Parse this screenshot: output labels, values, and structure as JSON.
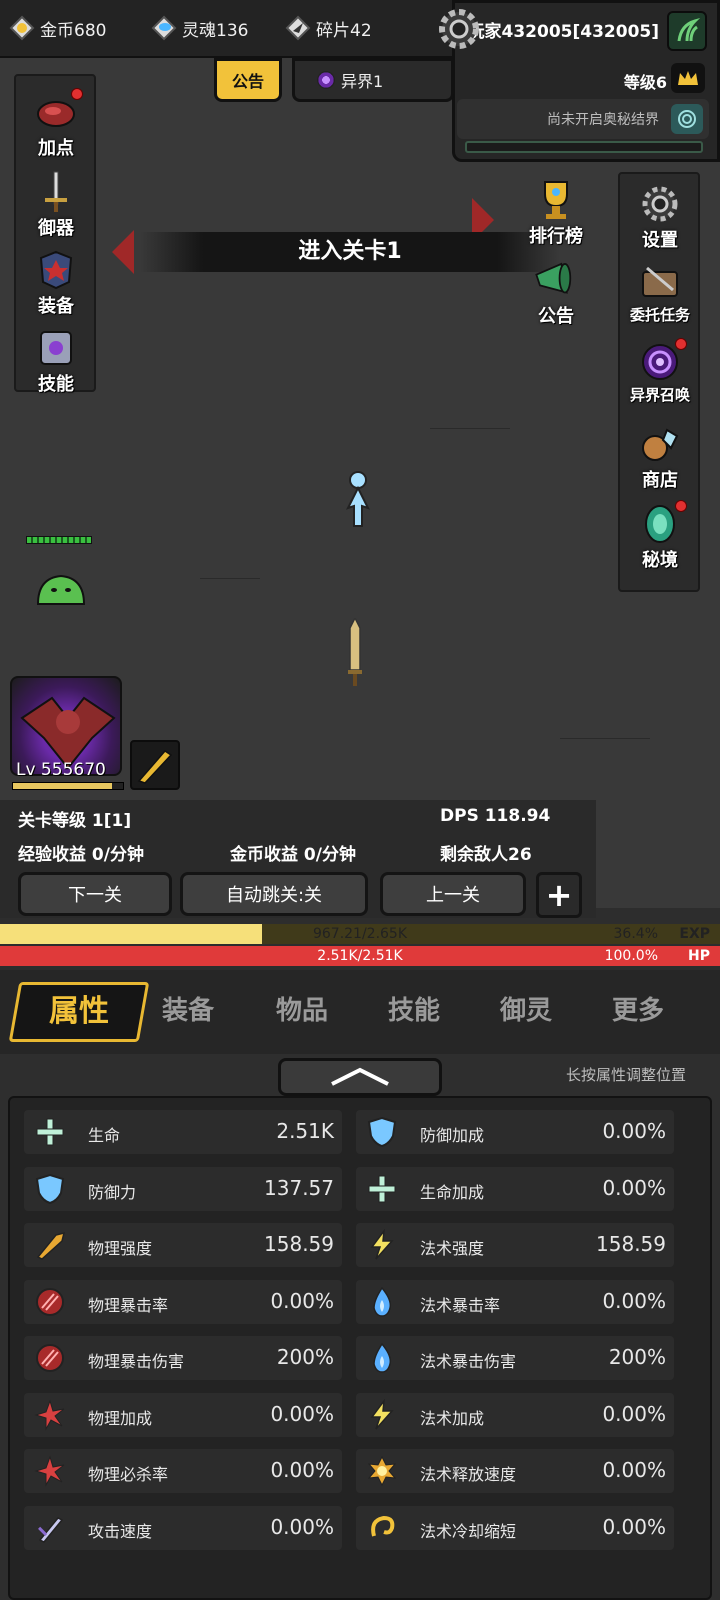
{
  "resources": {
    "gold": "金币680",
    "soul": "灵魂136",
    "shard": "碎片42"
  },
  "player": {
    "name": "玩家432005[432005]",
    "level": "等级6",
    "secret_status": "尚未开启奥秘结界"
  },
  "top_tabs": {
    "notice": "公告",
    "world": "异界1"
  },
  "left_menu": [
    "加点",
    "御器",
    "装备",
    "技能"
  ],
  "scene": {
    "ranking": "排行榜",
    "notice": "公告",
    "stage_title": "进入关卡1"
  },
  "right_menu": [
    "设置",
    "委托任务",
    "异界召唤",
    "商店",
    "秘境"
  ],
  "hero": {
    "level_label": "Lv 555670",
    "xp_fraction": 0.9
  },
  "stats": {
    "stage_level": "关卡等级 1[1]",
    "dps": "DPS  118.94",
    "exp_income": "经验收益 0/分钟",
    "gold_income": "金币收益 0/分钟",
    "enemies_left": "剩余敌人26"
  },
  "stage_buttons": {
    "next": "下一关",
    "auto": "自动跳关:关",
    "prev": "上一关",
    "plus": "+"
  },
  "exp_bar": {
    "text": "967.21/2.65K",
    "percent": "36.4%",
    "tag": "EXP",
    "fraction": 0.364
  },
  "hp_bar": {
    "text": "2.51K/2.51K",
    "percent": "100.0%",
    "tag": "HP",
    "fraction": 1.0
  },
  "bottom_tabs": [
    "属性",
    "装备",
    "物品",
    "技能",
    "御灵",
    "更多"
  ],
  "attr_hint": "长按属性调整位置",
  "attributes_left": [
    {
      "name": "生命",
      "value": "2.51K",
      "icon": "plus-icon"
    },
    {
      "name": "防御力",
      "value": "137.57",
      "icon": "shield-icon"
    },
    {
      "name": "物理强度",
      "value": "158.59",
      "icon": "blade-icon"
    },
    {
      "name": "物理暴击率",
      "value": "0.00%",
      "icon": "claw-icon"
    },
    {
      "name": "物理暴击伤害",
      "value": "200%",
      "icon": "claw-icon"
    },
    {
      "name": "物理加成",
      "value": "0.00%",
      "icon": "burst-icon"
    },
    {
      "name": "物理必杀率",
      "value": "0.00%",
      "icon": "burst-icon"
    },
    {
      "name": "攻击速度",
      "value": "0.00%",
      "icon": "sword-icon"
    }
  ],
  "attributes_right": [
    {
      "name": "防御加成",
      "value": "0.00%",
      "icon": "shield-icon"
    },
    {
      "name": "生命加成",
      "value": "0.00%",
      "icon": "plus-icon"
    },
    {
      "name": "法术强度",
      "value": "158.59",
      "icon": "lightning-icon"
    },
    {
      "name": "法术暴击率",
      "value": "0.00%",
      "icon": "flame-icon"
    },
    {
      "name": "法术暴击伤害",
      "value": "200%",
      "icon": "flame-icon"
    },
    {
      "name": "法术加成",
      "value": "0.00%",
      "icon": "lightning-icon"
    },
    {
      "name": "法术释放速度",
      "value": "0.00%",
      "icon": "sun-icon"
    },
    {
      "name": "法术冷却缩短",
      "value": "0.00%",
      "icon": "swirl-icon"
    }
  ],
  "colors": {
    "accent": "#f2c23a",
    "exp": "#f6e07a",
    "hp": "#e03a3a"
  }
}
